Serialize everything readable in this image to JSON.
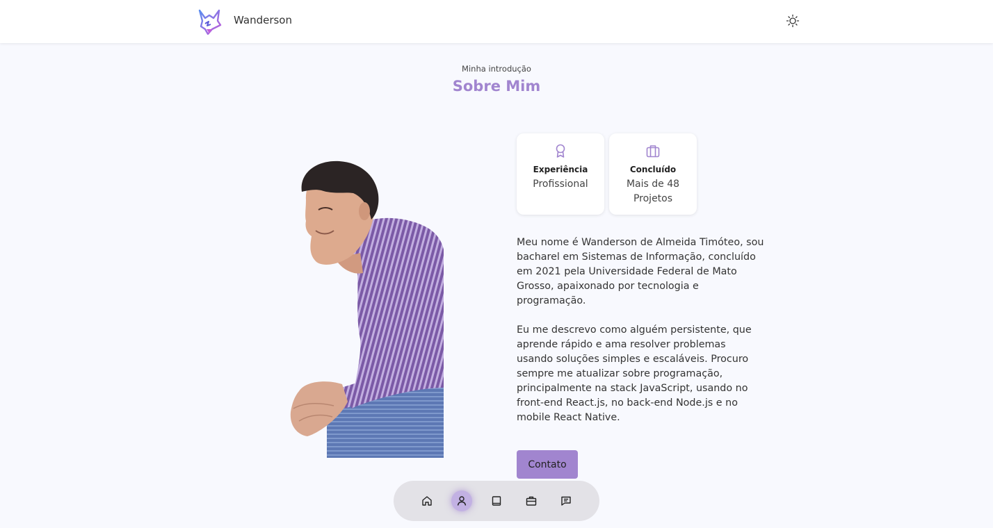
{
  "header": {
    "brand_name": "Wanderson",
    "logo_icon": "wolf-logo-icon",
    "theme_icon": "sun-icon"
  },
  "section": {
    "subtitle": "Minha introdução",
    "title": "Sobre Mim"
  },
  "cards": [
    {
      "icon": "award-icon",
      "title": "Experiência",
      "value": "Profissional"
    },
    {
      "icon": "briefcase-icon",
      "title": "Concluído",
      "value": "Mais de 48 Projetos"
    }
  ],
  "about": {
    "paragraphs": [
      "Meu nome é Wanderson de Almeida Timóteo, sou bacharel em Sistemas de Informação, concluído em 2021 pela Universidade Federal de Mato Grosso, apaixonado por tecnologia e programação.",
      "Eu me descrevo como alguém persistente, que aprende rápido e ama resolver problemas usando soluções simples e escaláveis. Procuro sempre me atualizar sobre programação, principalmente na stack JavaScript, usando no front-end React.js, no back-end Node.js e no mobile React Native."
    ],
    "contact_label": "Contato"
  },
  "bottom_nav": {
    "items": [
      {
        "icon": "home-icon",
        "active": false
      },
      {
        "icon": "user-icon",
        "active": true
      },
      {
        "icon": "book-icon",
        "active": false
      },
      {
        "icon": "briefcase-icon",
        "active": false
      },
      {
        "icon": "message-icon",
        "active": false
      }
    ]
  },
  "colors": {
    "accent": "#a185cf",
    "background": "#f8f9fe",
    "header_bg": "#ffffff",
    "nav_bg": "#e3e2e7"
  }
}
